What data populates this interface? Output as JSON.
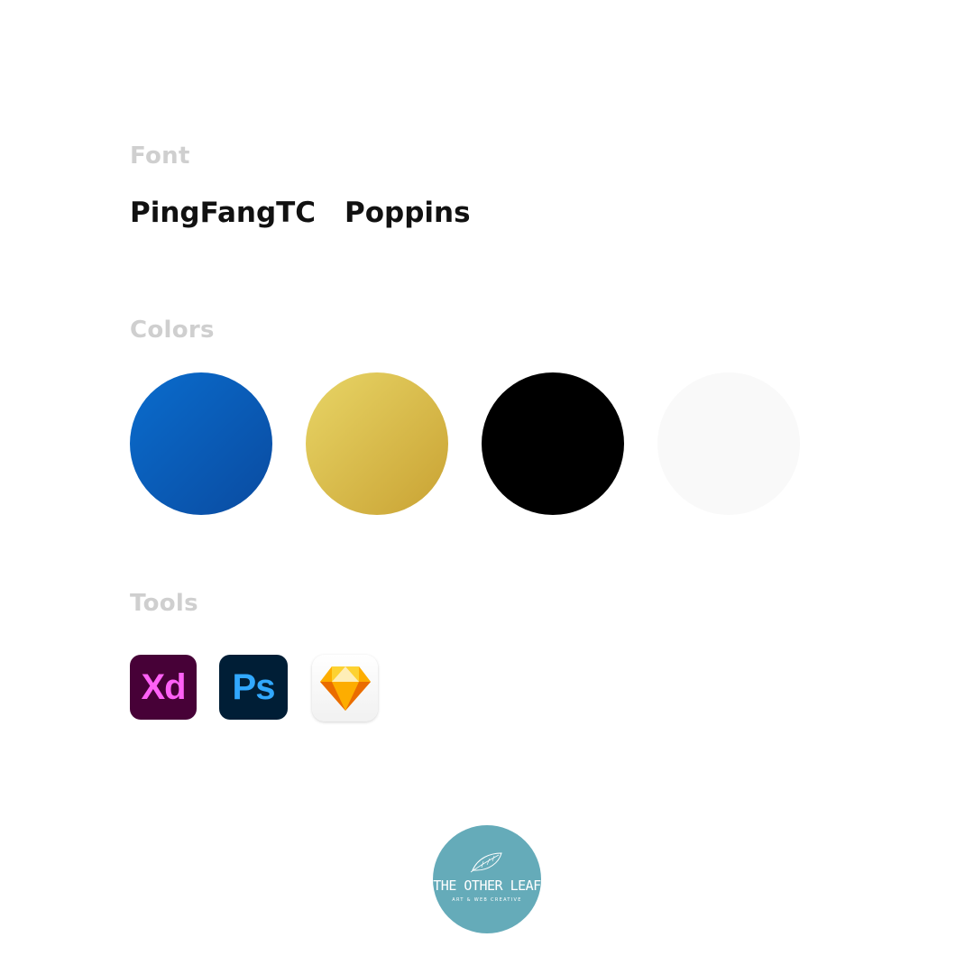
{
  "font_section": {
    "label": "Font",
    "fonts": [
      "PingFangTC",
      "Poppins"
    ]
  },
  "colors_section": {
    "label": "Colors",
    "swatches": [
      "#0a5fb8",
      "#d9b84a",
      "#000000",
      "#f9f9f9"
    ]
  },
  "tools_section": {
    "label": "Tools",
    "tools": [
      {
        "name": "Adobe XD",
        "text": "Xd",
        "icon": "xd-icon"
      },
      {
        "name": "Adobe Photoshop",
        "text": "Ps",
        "icon": "ps-icon"
      },
      {
        "name": "Sketch",
        "icon": "sketch-diamond-icon"
      }
    ]
  },
  "logo": {
    "title": "THE OTHER LEAF",
    "subtitle": "ART & WEB CREATIVE",
    "icon": "leaf-icon",
    "color": "#65abb9"
  }
}
